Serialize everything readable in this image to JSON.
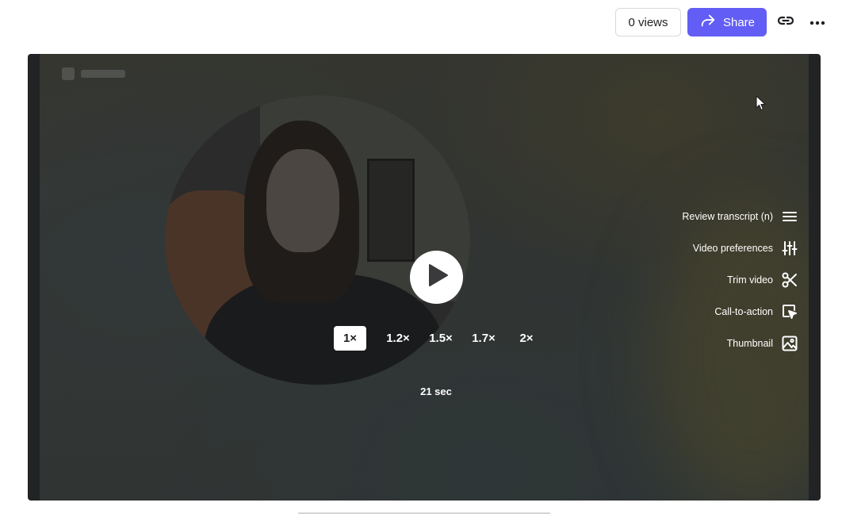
{
  "header": {
    "views_label": "0 views",
    "share_label": "Share"
  },
  "player": {
    "speeds": [
      "1×",
      "1.2×",
      "1.5×",
      "1.7×",
      "2×"
    ],
    "active_speed": "1×",
    "duration": "21 sec"
  },
  "side_menu": [
    {
      "label": "Review transcript (n)",
      "icon": "list-icon"
    },
    {
      "label": "Video preferences",
      "icon": "sliders-icon"
    },
    {
      "label": "Trim video",
      "icon": "scissors-icon"
    },
    {
      "label": "Call-to-action",
      "icon": "cursor-click-icon"
    },
    {
      "label": "Thumbnail",
      "icon": "image-icon"
    }
  ],
  "colors": {
    "accent": "#625df5",
    "player_bg": "#212325"
  }
}
